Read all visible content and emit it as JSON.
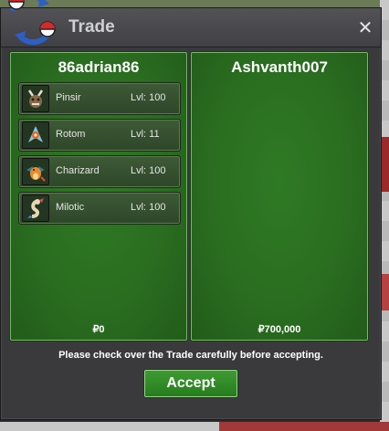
{
  "window": {
    "title": "Trade",
    "close_glyph": "✕"
  },
  "left_trader": {
    "name": "86adrian86",
    "money": "₽0",
    "pokemon": [
      {
        "name": "Pinsir",
        "level": "Lvl: 100",
        "icon": "pinsir-icon"
      },
      {
        "name": "Rotom",
        "level": "Lvl: 11",
        "icon": "rotom-icon"
      },
      {
        "name": "Charizard",
        "level": "Lvl: 100",
        "icon": "charizard-icon"
      },
      {
        "name": "Milotic",
        "level": "Lvl: 100",
        "icon": "milotic-icon"
      }
    ]
  },
  "right_trader": {
    "name": "Ashvanth007",
    "money": "₽700,000",
    "pokemon": []
  },
  "notice": "Please check over the Trade carefully before accepting.",
  "accept_label": "Accept",
  "colors": {
    "panel_green": "#2a6d20",
    "accept_green": "#2f8a26",
    "window_gray": "#3a3a3d"
  }
}
